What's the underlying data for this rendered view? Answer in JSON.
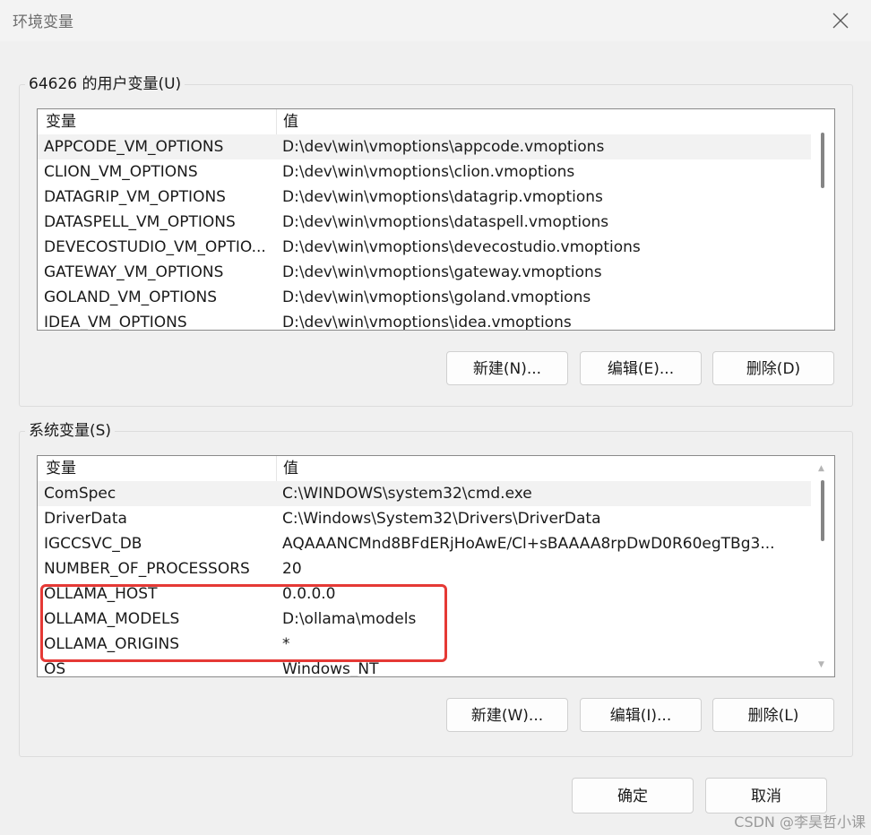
{
  "window": {
    "title": "环境变量",
    "close_icon": "close-icon"
  },
  "user_vars": {
    "group_label": "64626 的用户变量(U)",
    "columns": [
      "变量",
      "值"
    ],
    "rows": [
      {
        "name": "APPCODE_VM_OPTIONS",
        "value": "D:\\dev\\win\\vmoptions\\appcode.vmoptions"
      },
      {
        "name": "CLION_VM_OPTIONS",
        "value": "D:\\dev\\win\\vmoptions\\clion.vmoptions"
      },
      {
        "name": "DATAGRIP_VM_OPTIONS",
        "value": "D:\\dev\\win\\vmoptions\\datagrip.vmoptions"
      },
      {
        "name": "DATASPELL_VM_OPTIONS",
        "value": "D:\\dev\\win\\vmoptions\\dataspell.vmoptions"
      },
      {
        "name": "DEVECOSTUDIO_VM_OPTIO...",
        "value": "D:\\dev\\win\\vmoptions\\devecostudio.vmoptions"
      },
      {
        "name": "GATEWAY_VM_OPTIONS",
        "value": "D:\\dev\\win\\vmoptions\\gateway.vmoptions"
      },
      {
        "name": "GOLAND_VM_OPTIONS",
        "value": "D:\\dev\\win\\vmoptions\\goland.vmoptions"
      },
      {
        "name": "IDEA_VM_OPTIONS",
        "value": "D:\\dev\\win\\vmoptions\\idea.vmoptions"
      }
    ],
    "buttons": {
      "new": "新建(N)...",
      "edit": "编辑(E)...",
      "delete": "删除(D)"
    }
  },
  "system_vars": {
    "group_label": "系统变量(S)",
    "columns": [
      "变量",
      "值"
    ],
    "rows": [
      {
        "name": "ComSpec",
        "value": "C:\\WINDOWS\\system32\\cmd.exe"
      },
      {
        "name": "DriverData",
        "value": "C:\\Windows\\System32\\Drivers\\DriverData"
      },
      {
        "name": "IGCCSVC_DB",
        "value": "AQAAANCMnd8BFdERjHoAwE/Cl+sBAAAA8rpDwD0R60egTBg3..."
      },
      {
        "name": "NUMBER_OF_PROCESSORS",
        "value": "20"
      },
      {
        "name": "OLLAMA_HOST",
        "value": "0.0.0.0"
      },
      {
        "name": "OLLAMA_MODELS",
        "value": "D:\\ollama\\models"
      },
      {
        "name": "OLLAMA_ORIGINS",
        "value": "*"
      },
      {
        "name": "OS",
        "value": "Windows_NT"
      }
    ],
    "buttons": {
      "new": "新建(W)...",
      "edit": "编辑(I)...",
      "delete": "删除(L)"
    }
  },
  "footer": {
    "ok": "确定",
    "cancel": "取消"
  },
  "watermark": "CSDN @李昊哲小课",
  "colors": {
    "highlight": "#e53935",
    "selected_row": "#f2f2f2"
  }
}
